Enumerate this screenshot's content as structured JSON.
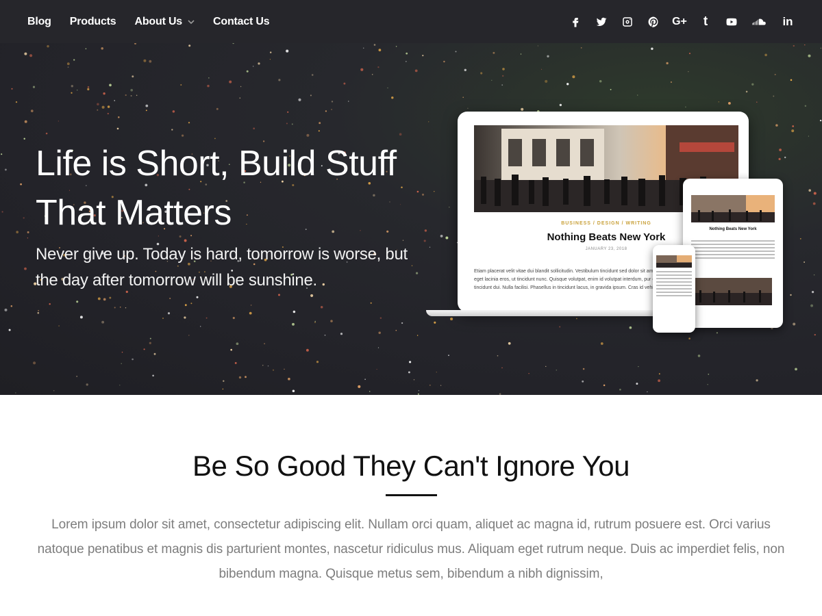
{
  "nav": {
    "items": [
      {
        "label": "Blog"
      },
      {
        "label": "Products"
      },
      {
        "label": "About Us",
        "has_dropdown": true
      },
      {
        "label": "Contact Us"
      }
    ],
    "social_icons": [
      "facebook-icon",
      "twitter-icon",
      "instagram-icon",
      "pinterest-icon",
      "google-plus-icon",
      "tumblr-icon",
      "youtube-icon",
      "soundcloud-icon",
      "linkedin-icon"
    ],
    "google_plus_glyph": "G+",
    "tumblr_glyph": "t",
    "linkedin_glyph": "in"
  },
  "hero": {
    "title": "Life is Short, Build Stuff That Matters",
    "subtitle": "Never give up. Today is hard, tomorrow is worse, but the day after tomorrow will be sunshine.",
    "mockup": {
      "category": "BUSINESS / DESIGN / WRITING",
      "post_title": "Nothing Beats New York",
      "date": "JANUARY 23, 2018",
      "excerpt": "Etiam placerat velit vitae dui blandit sollicitudin. Vestibulum tincidunt sed dolor sit amet vo Nunc eget lacinia eros, ut tincidunt nunc. Quisque volutpat, enim id volutpat interdum, pur dolor tincidunt dui. Nulla facilisi. Phasellus in tincidunt lacus, in gravida ipsum. Cras id vehi",
      "tablet_title": "Nothing Beats New York"
    }
  },
  "section": {
    "title": "Be So Good They Can't Ignore You",
    "body": "Lorem ipsum dolor sit amet, consectetur adipiscing elit. Nullam orci quam, aliquet ac magna id, rutrum posuere est. Orci varius natoque penatibus et magnis dis parturient montes, nascetur ridiculus mus. Aliquam eget rutrum neque. Duis ac imperdiet felis, non bibendum magna. Quisque metus sem, bibendum a nibh dignissim,"
  },
  "colors": {
    "nav_bg": "#26262b",
    "hero_bg": "#232329",
    "accent_gold": "#c9a13a",
    "body_text": "#7d7d7d"
  }
}
